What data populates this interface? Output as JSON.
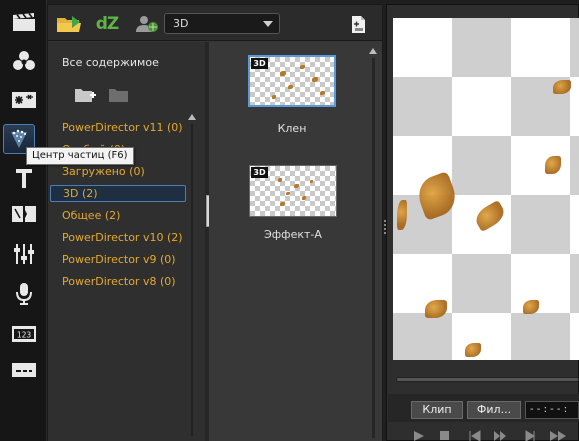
{
  "tooltip": {
    "text": "Центр частиц (F6)"
  },
  "rail": {
    "items": [
      {
        "name": "media-room",
        "icon": "clapperboard-icon"
      },
      {
        "name": "effect-room",
        "icon": "effects-icon"
      },
      {
        "name": "pip-room",
        "icon": "pip-objects-icon"
      },
      {
        "name": "particle-room",
        "icon": "particle-icon",
        "active": true
      },
      {
        "name": "title-room",
        "icon": "title-icon"
      },
      {
        "name": "transition-room",
        "icon": "transition-icon"
      },
      {
        "name": "audio-mixing-room",
        "icon": "mixer-icon"
      },
      {
        "name": "voiceover-room",
        "icon": "microphone-icon"
      },
      {
        "name": "chapter-room",
        "icon": "chapter-icon"
      },
      {
        "name": "subtitle-room",
        "icon": "subtitle-icon"
      }
    ]
  },
  "toolbar": {
    "import_icon": "folder-import-icon",
    "dz_label": "dZ",
    "download_icon": "download-user-icon",
    "filter_value": "3D",
    "new_icon": "new-particle-icon"
  },
  "categories": {
    "title": "Все содержимое",
    "add_icon": "add-folder-icon",
    "remove_icon": "folder-icon",
    "items": [
      {
        "label": "PowerDirector v11  (0)"
      },
      {
        "label": "Особый  (0)"
      },
      {
        "label": "Загружено  (0)"
      },
      {
        "label": "3D  (2)",
        "selected": true
      },
      {
        "label": "Общее  (2)"
      },
      {
        "label": "PowerDirector v10  (2)"
      },
      {
        "label": "PowerDirector v9  (0)"
      },
      {
        "label": "PowerDirector v8  (0)"
      }
    ]
  },
  "content": {
    "items": [
      {
        "label": "Клен",
        "badge": "3D",
        "selected": true
      },
      {
        "label": "Эффект-A",
        "badge": "3D",
        "selected": false
      }
    ]
  },
  "preview": {
    "clip_button": "Клип",
    "film_button": "Фил...",
    "timecode": "- - : - - :"
  },
  "colors": {
    "category_text": "#e6a92a",
    "accent_border": "#4a7fb5",
    "leaf": "#b8782a"
  }
}
